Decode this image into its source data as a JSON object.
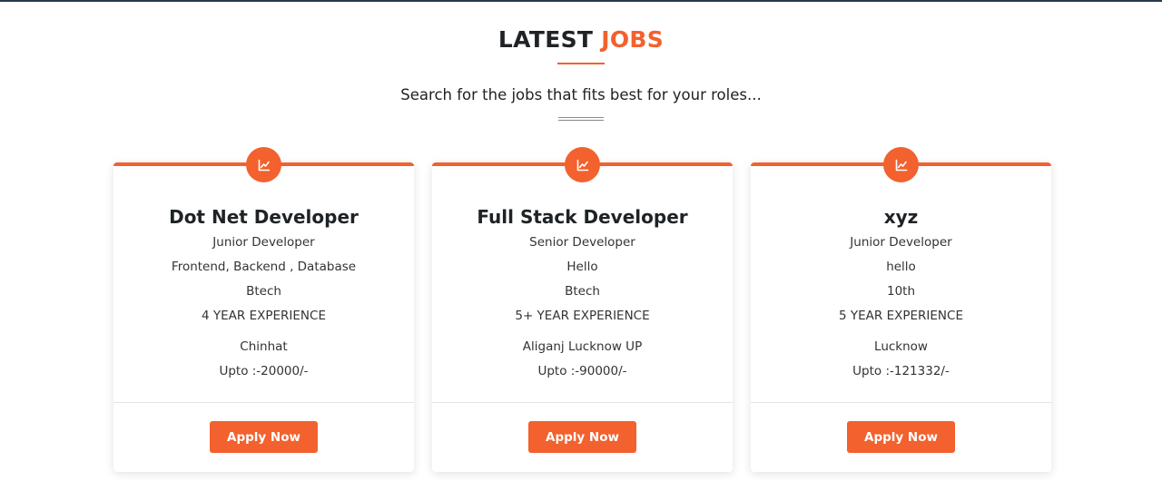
{
  "header": {
    "title_main": "LATEST",
    "title_accent": "JOBS",
    "subtitle": "Search for the jobs that fits best for your roles..."
  },
  "colors": {
    "accent": "#f2612e",
    "topbar": "#27394a"
  },
  "cards": [
    {
      "icon": "chart-line-icon",
      "title": "Dot Net Developer",
      "level": "Junior Developer",
      "description": "Frontend, Backend , Database",
      "qualification": "Btech",
      "experience": "4 YEAR EXPERIENCE",
      "location": "Chinhat",
      "salary": "Upto :-20000/-",
      "button": "Apply Now"
    },
    {
      "icon": "chart-line-icon",
      "title": "Full Stack Developer",
      "level": "Senior Developer",
      "description": "Hello",
      "qualification": "Btech",
      "experience": "5+ YEAR EXPERIENCE",
      "location": "Aliganj Lucknow UP",
      "salary": "Upto :-90000/-",
      "button": "Apply Now"
    },
    {
      "icon": "chart-line-icon",
      "title": "xyz",
      "level": "Junior Developer",
      "description": "hello",
      "qualification": "10th",
      "experience": "5 YEAR EXPERIENCE",
      "location": "Lucknow",
      "salary": "Upto :-121332/-",
      "button": "Apply Now"
    }
  ]
}
